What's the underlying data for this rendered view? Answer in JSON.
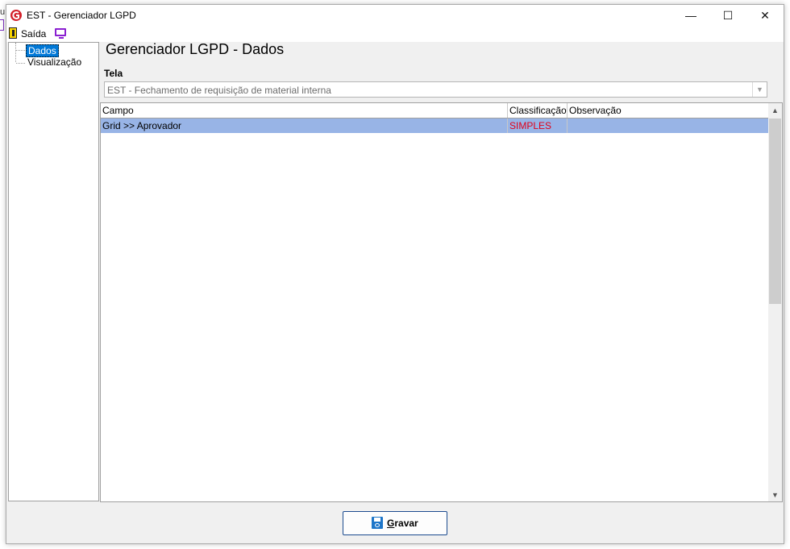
{
  "background": {
    "fragment_text": "u"
  },
  "window": {
    "title": "EST - Gerenciador LGPD",
    "controls": {
      "minimize": "—",
      "maximize": "☐",
      "close": "✕"
    }
  },
  "toolbar": {
    "exit_label": "Saída",
    "exit_icon": "door-exit-icon",
    "monitor_icon": "monitor-icon"
  },
  "tree": {
    "items": [
      {
        "label": "Dados",
        "selected": true
      },
      {
        "label": "Visualização",
        "selected": false
      }
    ]
  },
  "page": {
    "title": "Gerenciador LGPD - Dados"
  },
  "tela": {
    "label": "Tela",
    "value": "EST - Fechamento de requisição de material interna"
  },
  "grid": {
    "columns": [
      "Campo",
      "Classificação",
      "Observação"
    ],
    "rows": [
      {
        "campo": "Grid >> Aprovador",
        "classificacao": "SIMPLES",
        "observacao": ""
      }
    ]
  },
  "save_button": {
    "label": "Gravar"
  },
  "colors": {
    "selection": "#0078d7",
    "row_highlight": "#98b4e6",
    "classification_text": "#e0001a",
    "monitor_icon": "#8a1fd1"
  }
}
